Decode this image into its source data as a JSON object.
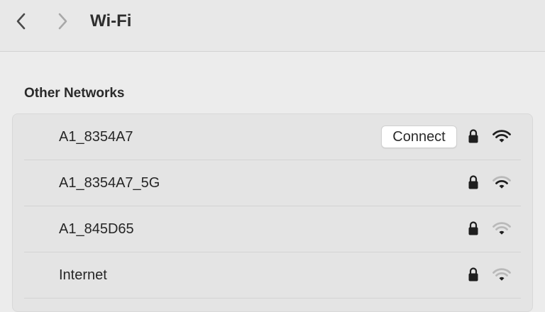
{
  "toolbar": {
    "title": "Wi-Fi",
    "back_icon": "chevron-left-icon",
    "forward_icon": "chevron-right-icon"
  },
  "section": {
    "title": "Other Networks"
  },
  "networks": [
    {
      "name": "A1_8354A7",
      "secured": true,
      "signal_bars": 3,
      "hovered": true,
      "connect_label": "Connect"
    },
    {
      "name": "A1_8354A7_5G",
      "secured": true,
      "signal_bars": 2
    },
    {
      "name": "A1_845D65",
      "secured": true,
      "signal_bars": 1
    },
    {
      "name": "Internet",
      "secured": true,
      "signal_bars": 1
    }
  ],
  "colors": {
    "background": "#ececec",
    "list_background": "#e4e4e4",
    "signal_active": "#1f1f1f",
    "signal_inactive": "#b9b9b9"
  }
}
